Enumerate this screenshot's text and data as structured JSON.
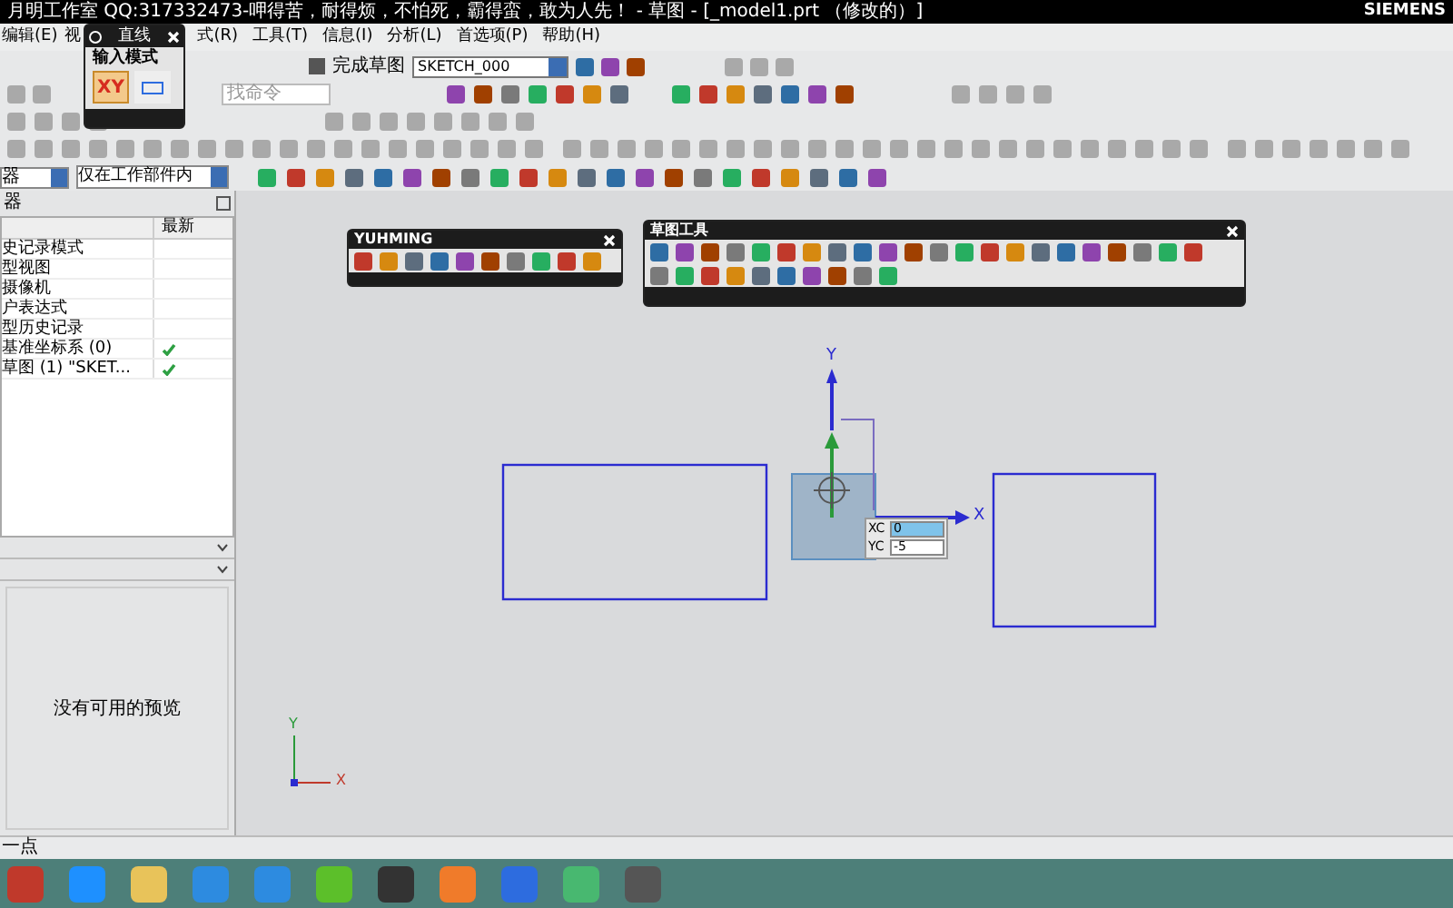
{
  "title": "月明工作室 QQ:317332473-呷得苦，耐得烦，不怕死，霸得蛮，敢为人先！ - 草图 - [_model1.prt （修改的）]",
  "brand": "SIEMENS",
  "menu": [
    "编辑(E)",
    "视",
    "式(R)",
    "工具(T)",
    "信息(I)",
    "分析(L)",
    "首选项(P)",
    "帮助(H)"
  ],
  "popup": {
    "title": "直线",
    "section_label": "输入模式",
    "modes": [
      {
        "kind": "text",
        "label": "XY",
        "selected": true
      },
      {
        "kind": "icon",
        "selected": false
      }
    ]
  },
  "sketch_toolbar": {
    "finish_label": "完成草图",
    "sketch_name": "SKETCH_000"
  },
  "search": {
    "placeholder": "找命令"
  },
  "selection": {
    "filter": "器",
    "scope": "仅在工作部件内"
  },
  "navigator": {
    "title": "器",
    "column": "最新",
    "rows": [
      {
        "label": "史记录模式",
        "checked": false
      },
      {
        "label": "型视图",
        "checked": false
      },
      {
        "label": "摄像机",
        "checked": false
      },
      {
        "label": "户表达式",
        "checked": false
      },
      {
        "label": "型历史记录",
        "checked": false
      },
      {
        "label": "基准坐标系 (0)",
        "checked": true
      },
      {
        "label": "草图 (1) \"SKET...",
        "checked": true
      }
    ]
  },
  "preview": {
    "message": "没有可用的预览"
  },
  "floating_toolbars": [
    {
      "title": "YUHMING"
    },
    {
      "title": "草图工具"
    }
  ],
  "coordinate_input": [
    {
      "label": "XC",
      "value": "0",
      "selected": true
    },
    {
      "label": "YC",
      "value": "-5",
      "selected": false
    }
  ],
  "canvas_axes": {
    "x_label": "X",
    "y_label": "Y"
  },
  "triad_axes": {
    "x_label": "X",
    "y_label": "Y"
  },
  "status": "一点"
}
